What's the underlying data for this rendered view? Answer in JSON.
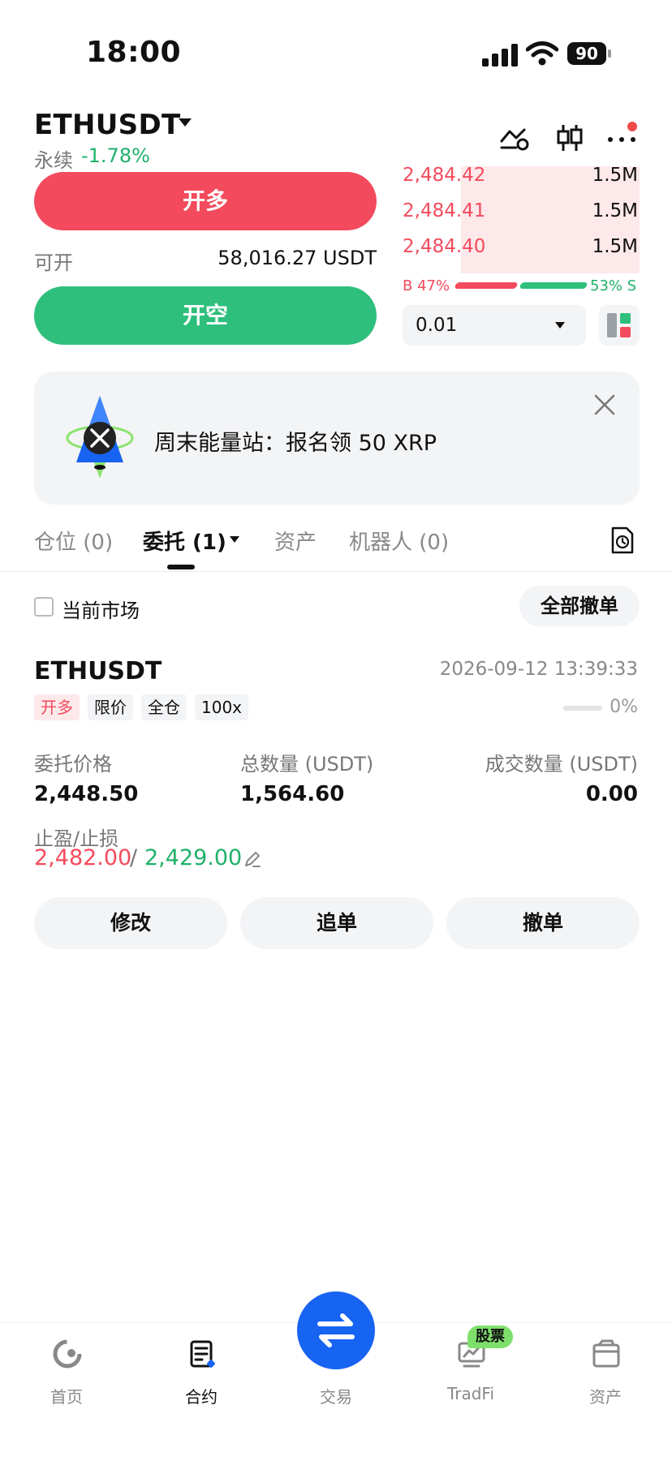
{
  "status_bar": {
    "time": "18:00",
    "battery": "90"
  },
  "header": {
    "symbol": "ETHUSDT",
    "contract_type": "永续",
    "change": "-1.78%"
  },
  "trade": {
    "long_label": "开多",
    "short_label": "开空",
    "available_label": "可开",
    "available_value": "58,016.27 USDT"
  },
  "order_book": {
    "asks": [
      {
        "price": "2,484.42",
        "qty": "1.5M"
      },
      {
        "price": "2,484.41",
        "qty": "1.5M"
      },
      {
        "price": "2,484.40",
        "qty": "1.5M"
      }
    ],
    "buy_ratio_label": "B 47%",
    "sell_ratio_label": "53% S",
    "buy_ratio": 0.47,
    "sell_ratio": 0.53,
    "tick_size": "0.01"
  },
  "banner": {
    "text": "周末能量站：报名领 50 XRP"
  },
  "tabs": [
    {
      "label": "仓位 (0)"
    },
    {
      "label": "委托 (1)"
    },
    {
      "label": "资产"
    },
    {
      "label": "机器人 (0)"
    }
  ],
  "filter": {
    "current_market_label": "当前市场",
    "cancel_all_label": "全部撤单"
  },
  "order": {
    "symbol": "ETHUSDT",
    "time": "2026-09-12 13:39:33",
    "tags": [
      "开多",
      "限价",
      "全仓",
      "100x"
    ],
    "progress": "0%",
    "price_label": "委托价格",
    "price_value": "2,448.50",
    "total_label": "总数量 (USDT)",
    "total_value": "1,564.60",
    "filled_label": "成交数量 (USDT)",
    "filled_value": "0.00",
    "tpsl_label": "止盈/止损",
    "tp_value": "2,482.00",
    "sl_value": "2,429.00",
    "separator": "/",
    "actions": [
      "修改",
      "追单",
      "撤单"
    ]
  },
  "nav": {
    "items": [
      "首页",
      "合约",
      "交易",
      "TradFi",
      "资产"
    ],
    "badge": "股票"
  },
  "colors": {
    "red": "#f34b5d",
    "green": "#2fbf7c",
    "blue": "#1763f2"
  }
}
